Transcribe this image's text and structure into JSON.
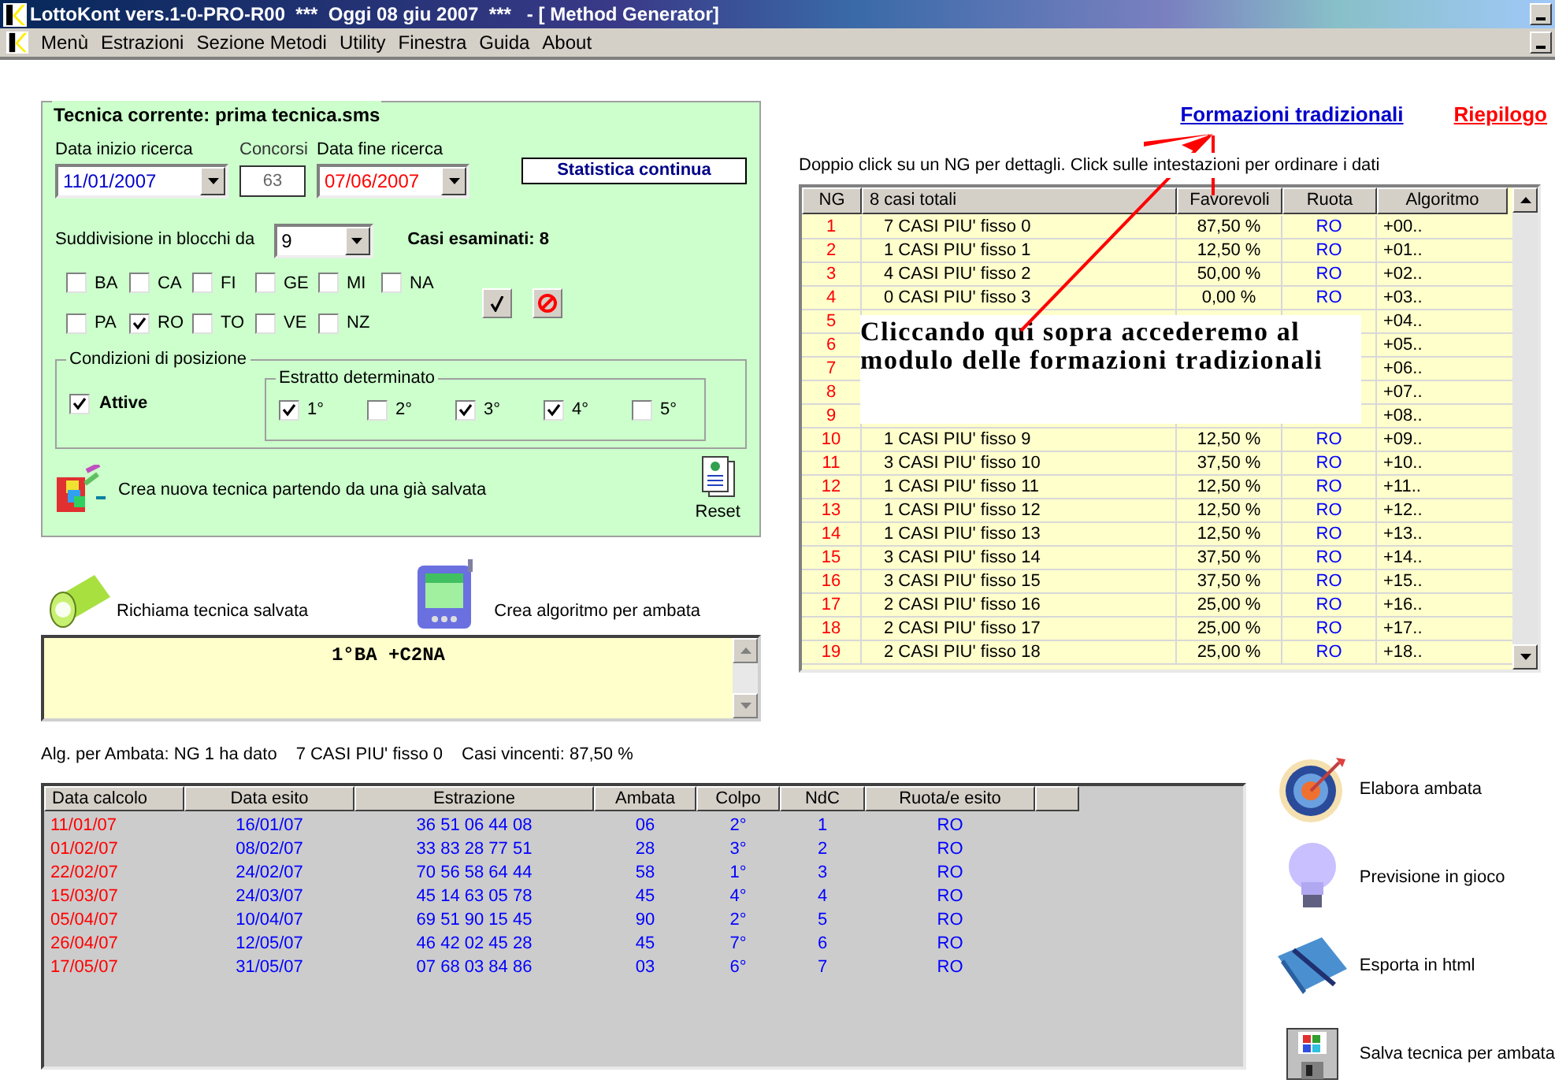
{
  "window": {
    "title": "LottoKont vers.1-0-PRO-R00  ***  Oggi 08 giu 2007  ***   - [ Method Generator]"
  },
  "menu": [
    "Menù",
    "Estrazioni",
    "Sezione Metodi",
    "Utility",
    "Finestra",
    "Guida",
    "About"
  ],
  "technique": {
    "title": "Tecnica corrente: prima tecnica.sms",
    "start": {
      "label": "Data inizio ricerca",
      "value": "11/01/2007"
    },
    "contests": {
      "label": "Concorsi",
      "value": "63"
    },
    "end": {
      "label": "Data fine ricerca",
      "value": "07/06/2007"
    },
    "stat_button": "Statistica continua",
    "blocks": {
      "label": "Suddivisione in blocchi da",
      "value": "9"
    },
    "cases": "Casi esaminati: 8",
    "wheels": [
      {
        "label": "BA",
        "checked": false
      },
      {
        "label": "CA",
        "checked": false
      },
      {
        "label": "FI",
        "checked": false
      },
      {
        "label": "GE",
        "checked": false
      },
      {
        "label": "MI",
        "checked": false
      },
      {
        "label": "NA",
        "checked": false
      },
      {
        "label": "PA",
        "checked": false
      },
      {
        "label": "RO",
        "checked": true
      },
      {
        "label": "TO",
        "checked": false
      },
      {
        "label": "VE",
        "checked": false
      },
      {
        "label": "NZ",
        "checked": false
      }
    ],
    "position": {
      "title": "Condizioni di posizione",
      "active": {
        "label": "Attive",
        "checked": true
      },
      "extract_title": "Estratto determinato",
      "positions": [
        {
          "label": "1°",
          "checked": true
        },
        {
          "label": "2°",
          "checked": false
        },
        {
          "label": "3°",
          "checked": true
        },
        {
          "label": "4°",
          "checked": true
        },
        {
          "label": "5°",
          "checked": false
        }
      ]
    },
    "new_from_saved": "Crea nuova tecnica partendo da una già salvata",
    "reset": "Reset"
  },
  "actions": {
    "recall": "Richiama tecnica salvata",
    "create_algo": "Crea algoritmo per ambata"
  },
  "formula": "1°BA +C2NA",
  "summary": [
    "Alg. per Ambata: NG 1 ha dato",
    "7 CASI PIU' fisso 0",
    "Casi vincenti: 87,50 %"
  ],
  "links": [
    {
      "label": "Formazioni tradizionali",
      "color": "#0000cc"
    },
    {
      "label": "Riepilogo",
      "color": "#ff0000"
    }
  ],
  "hint": "Doppio click su un NG per dettagli. Click sulle intestazioni per ordinare i dati",
  "ng_table": {
    "columns": [
      "NG",
      "8 casi totali",
      "Favorevoli",
      "Ruota",
      "Algoritmo"
    ],
    "rows": [
      {
        "ng": "1",
        "cases": "7 CASI PIU' fisso 0",
        "favorable": "87,50 %",
        "wheel": "RO",
        "algorithm": "+00.."
      },
      {
        "ng": "2",
        "cases": "1 CASI PIU' fisso 1",
        "favorable": "12,50 %",
        "wheel": "RO",
        "algorithm": "+01.."
      },
      {
        "ng": "3",
        "cases": "4 CASI PIU' fisso 2",
        "favorable": "50,00 %",
        "wheel": "RO",
        "algorithm": "+02.."
      },
      {
        "ng": "4",
        "cases": "0 CASI PIU' fisso 3",
        "favorable": "0,00 %",
        "wheel": "RO",
        "algorithm": "+03.."
      },
      {
        "ng": "5",
        "algorithm": "+04.."
      },
      {
        "ng": "6",
        "algorithm": "+05.."
      },
      {
        "ng": "7",
        "algorithm": "+06.."
      },
      {
        "ng": "8",
        "algorithm": "+07.."
      },
      {
        "ng": "9",
        "algorithm": "+08.."
      },
      {
        "ng": "10",
        "cases": "1 CASI PIU' fisso 9",
        "favorable": "12,50 %",
        "wheel": "RO",
        "algorithm": "+09.."
      },
      {
        "ng": "11",
        "cases": "3 CASI PIU' fisso 10",
        "favorable": "37,50 %",
        "wheel": "RO",
        "algorithm": "+10.."
      },
      {
        "ng": "12",
        "cases": "1 CASI PIU' fisso 11",
        "favorable": "12,50 %",
        "wheel": "RO",
        "algorithm": "+11.."
      },
      {
        "ng": "13",
        "cases": "1 CASI PIU' fisso 12",
        "favorable": "12,50 %",
        "wheel": "RO",
        "algorithm": "+12.."
      },
      {
        "ng": "14",
        "cases": "1 CASI PIU' fisso 13",
        "favorable": "12,50 %",
        "wheel": "RO",
        "algorithm": "+13.."
      },
      {
        "ng": "15",
        "cases": "3 CASI PIU' fisso 14",
        "favorable": "37,50 %",
        "wheel": "RO",
        "algorithm": "+14.."
      },
      {
        "ng": "16",
        "cases": "3 CASI PIU' fisso 15",
        "favorable": "37,50 %",
        "wheel": "RO",
        "algorithm": "+15.."
      },
      {
        "ng": "17",
        "cases": "2 CASI PIU' fisso 16",
        "favorable": "25,00 %",
        "wheel": "RO",
        "algorithm": "+16.."
      },
      {
        "ng": "18",
        "cases": "2 CASI PIU' fisso 17",
        "favorable": "25,00 %",
        "wheel": "RO",
        "algorithm": "+17.."
      },
      {
        "ng": "19",
        "cases": "2 CASI PIU' fisso 18",
        "favorable": "25,00 %",
        "wheel": "RO",
        "algorithm": "+18.."
      }
    ]
  },
  "callout": "Cliccando qui sopra accederemo al modulo delle formazioni tradizionali",
  "results": {
    "columns": [
      "Data calcolo",
      "Data esito",
      "Estrazione",
      "Ambata",
      "Colpo",
      "NdC",
      "Ruota/e esito"
    ],
    "rows": [
      [
        "11/01/07",
        "16/01/07",
        "36 51 06 44 08",
        "06",
        "2°",
        "1",
        "RO"
      ],
      [
        "01/02/07",
        "08/02/07",
        "33 83 28 77 51",
        "28",
        "3°",
        "2",
        "RO"
      ],
      [
        "22/02/07",
        "24/02/07",
        "70 56 58 64 44",
        "58",
        "1°",
        "3",
        "RO"
      ],
      [
        "15/03/07",
        "24/03/07",
        "45 14 63 05 78",
        "45",
        "4°",
        "4",
        "RO"
      ],
      [
        "05/04/07",
        "10/04/07",
        "69 51 90 15 45",
        "90",
        "2°",
        "5",
        "RO"
      ],
      [
        "26/04/07",
        "12/05/07",
        "46 42 02 45 28",
        "45",
        "7°",
        "6",
        "RO"
      ],
      [
        "17/05/07",
        "31/05/07",
        "07 68 03 84 86",
        "03",
        "6°",
        "7",
        "RO"
      ]
    ]
  },
  "side_actions": [
    {
      "label": "Elabora ambata",
      "kind": "target"
    },
    {
      "label": "Previsione in gioco",
      "kind": "bulb"
    },
    {
      "label": "Esporta in html",
      "kind": "book"
    },
    {
      "label": "Salva tecnica per ambata",
      "kind": "floppy"
    }
  ]
}
